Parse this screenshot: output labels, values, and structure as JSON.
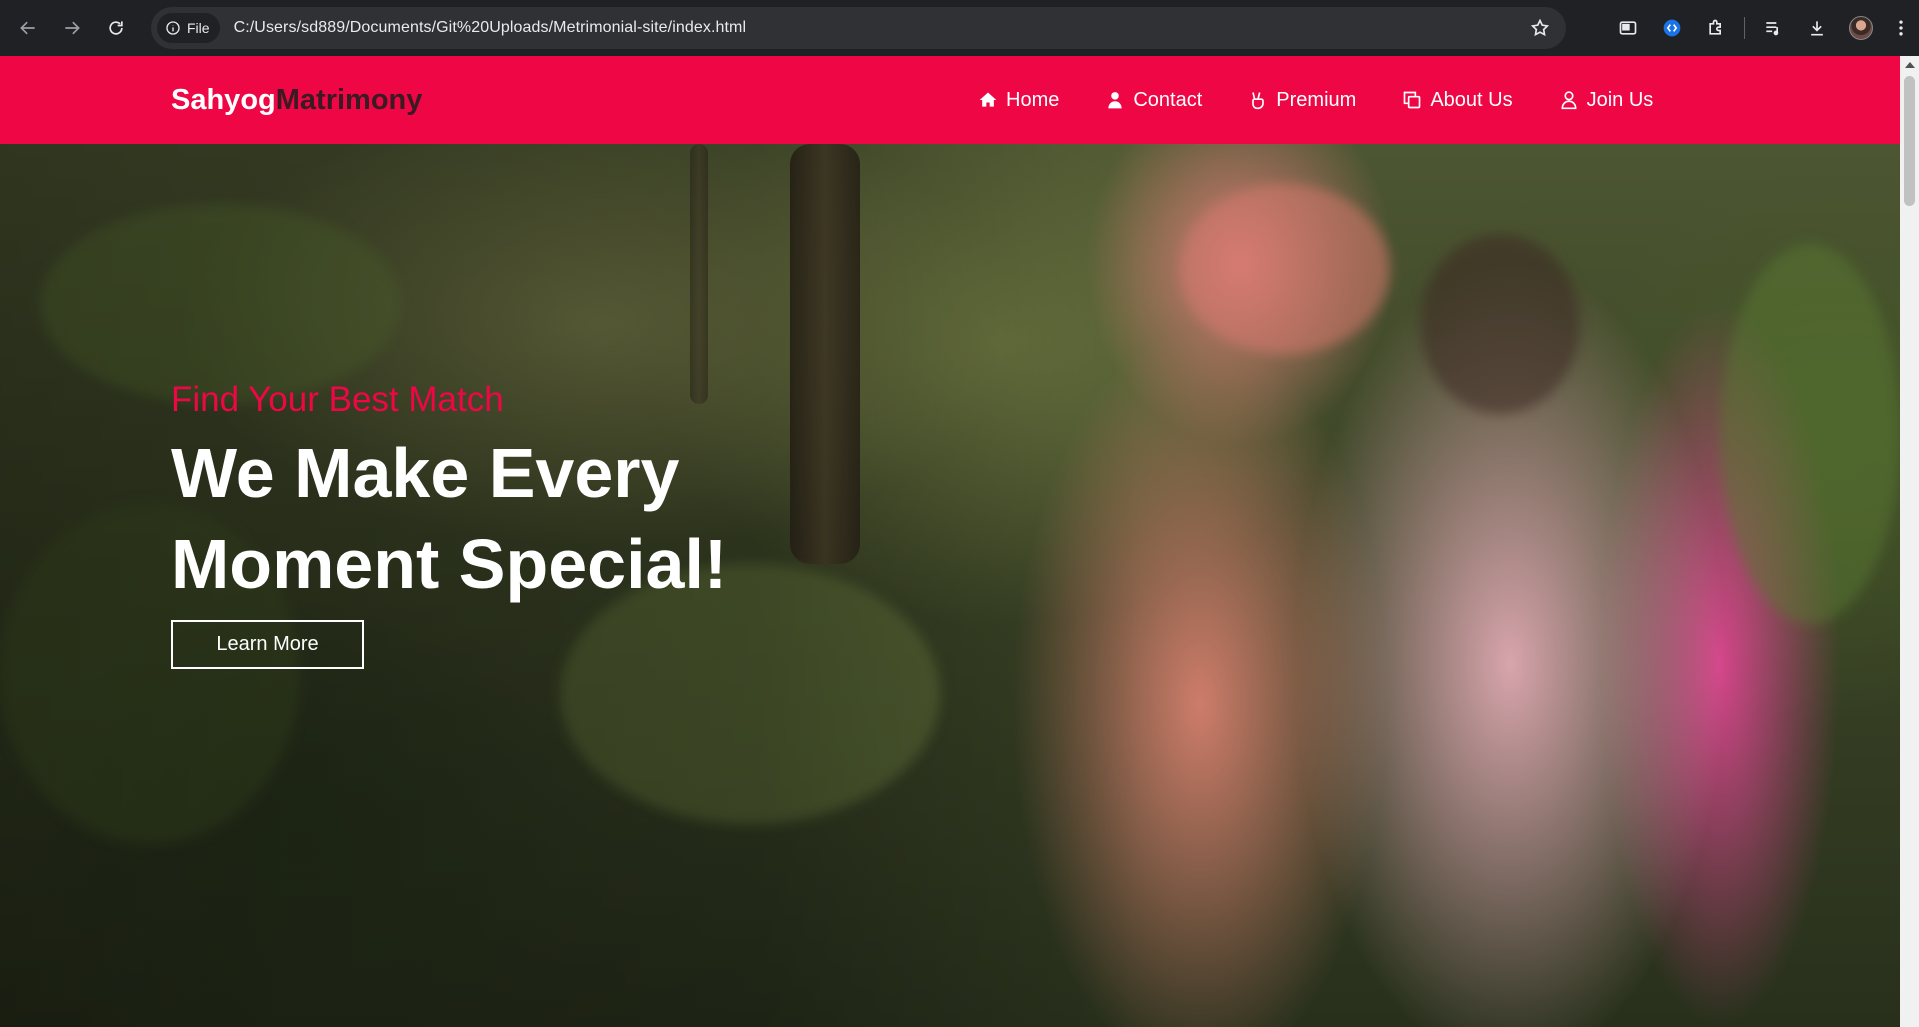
{
  "browser": {
    "chip_label": "File",
    "url": "C:/Users/sd889/Documents/Git%20Uploads/Metrimonial-site/index.html"
  },
  "site": {
    "brand_part1": "Sahyog",
    "brand_part2": "Matrimony",
    "brand_colors": {
      "primary": "#ee0645",
      "secondary": "#3a1b23"
    },
    "nav": [
      {
        "label": "Home",
        "icon": "home-icon"
      },
      {
        "label": "Contact",
        "icon": "user-icon"
      },
      {
        "label": "Premium",
        "icon": "victory-hand-icon"
      },
      {
        "label": "About Us",
        "icon": "copy-icon"
      },
      {
        "label": "Join Us",
        "icon": "user-outline-icon"
      }
    ]
  },
  "hero": {
    "tagline": "Find Your Best Match",
    "headline": "We Make Every Moment Special!",
    "cta_label": "Learn More"
  }
}
